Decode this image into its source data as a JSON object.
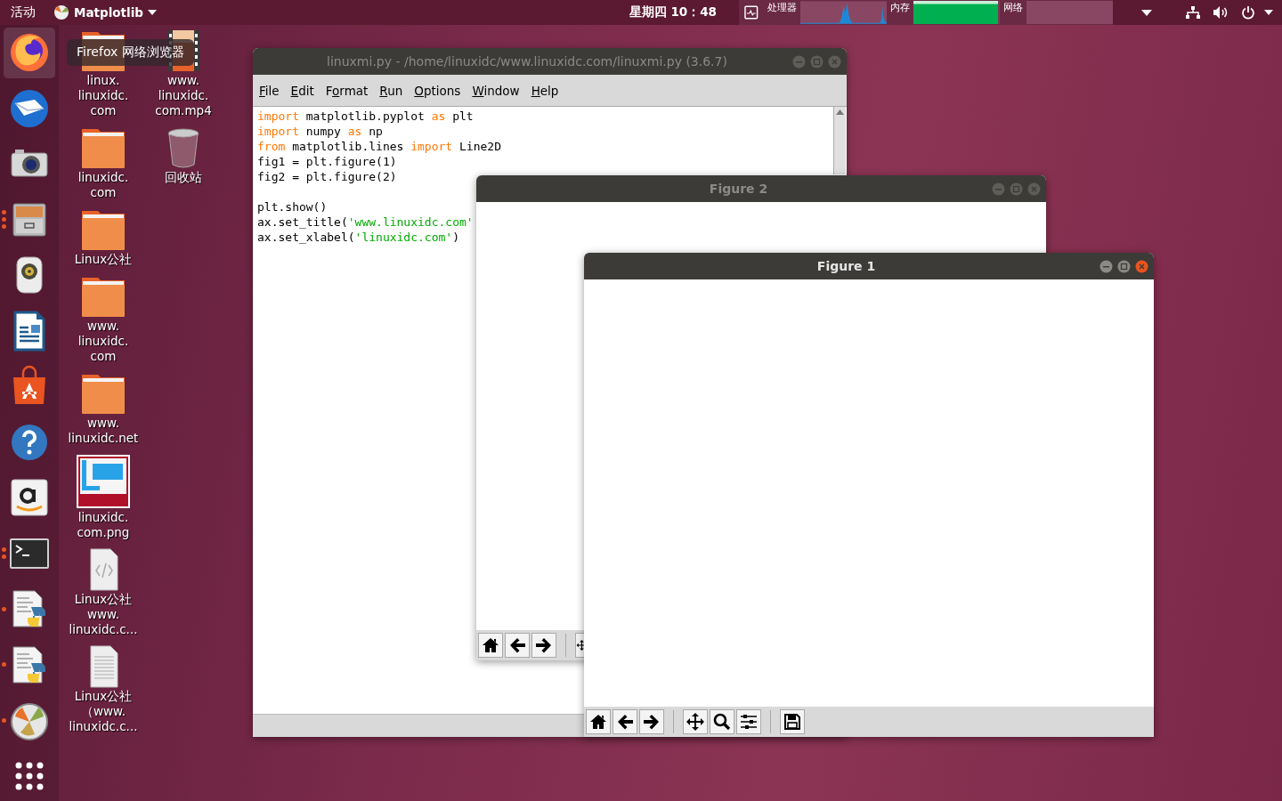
{
  "top_bar": {
    "activities": "活动",
    "app_menu": {
      "name": "Matplotlib"
    },
    "clock": "星期四 10：48",
    "monitor": {
      "cpu_label": "处理器",
      "memory_label": "内存",
      "memory": {
        "level": 0.98
      },
      "network_label": "网络"
    }
  },
  "dock": {
    "items": [
      {
        "kind": "firefox",
        "selected": true
      },
      {
        "kind": "mail",
        "selected": false
      },
      {
        "kind": "camera",
        "selected": false
      },
      {
        "kind": "files",
        "selected": false,
        "indicators": [
          {
            "kind": "dot"
          },
          {
            "kind": "dot"
          },
          {
            "kind": "dot"
          }
        ]
      },
      {
        "kind": "speaker",
        "selected": false
      },
      {
        "kind": "document",
        "selected": false
      },
      {
        "kind": "store",
        "selected": false
      },
      {
        "kind": "help",
        "selected": false
      },
      {
        "kind": "amazon",
        "selected": false
      },
      {
        "kind": "terminal",
        "selected": false,
        "indicators": [
          {
            "kind": "dot"
          },
          {
            "kind": "dot"
          }
        ]
      },
      {
        "kind": "python",
        "selected": false,
        "indicators": [
          {
            "kind": "dot"
          }
        ]
      },
      {
        "kind": "python",
        "selected": false,
        "indicators": [
          {
            "kind": "dot"
          }
        ]
      },
      {
        "kind": "plot",
        "selected": false,
        "indicators": [
          {
            "kind": "dot"
          }
        ]
      },
      {
        "kind": "grid",
        "selected": false
      }
    ],
    "tooltip": "Firefox 网络浏览器"
  },
  "desktop": {
    "columns": [
      {
        "items": [
          {
            "kind": "folder",
            "label_lines": [
              "linux.",
              "linuxidc.",
              "com"
            ]
          },
          {
            "kind": "folder",
            "label_lines": [
              "linuxidc.",
              "com"
            ]
          },
          {
            "kind": "folder",
            "label_lines": [
              "Linux公社"
            ]
          },
          {
            "kind": "folder",
            "label_lines": [
              "www.",
              "linuxidc.",
              "com"
            ]
          },
          {
            "kind": "folder",
            "label_lines": [
              "www.",
              "linuxidc.net"
            ]
          },
          {
            "kind": "image",
            "label_lines": [
              "linuxidc.",
              "com.png"
            ]
          },
          {
            "kind": "code",
            "label_lines": [
              "Linux公社",
              "www.",
              "linuxidc.c..."
            ]
          },
          {
            "kind": "text",
            "label_lines": [
              "Linux公社",
              "（www.",
              "linuxidc.c..."
            ]
          }
        ]
      },
      {
        "items": [
          {
            "kind": "video",
            "label_lines": [
              "www.",
              "linuxidc.",
              "com.mp4"
            ]
          },
          {
            "kind": "trash",
            "label_lines": [
              "回收站"
            ]
          }
        ]
      }
    ]
  },
  "editor": {
    "title": "linuxmi.py - /home/linuxidc/www.linuxidc.com/linuxmi.py (3.6.7)",
    "active": false,
    "menu": [
      {
        "key": "F",
        "after": "ile"
      },
      {
        "key": "E",
        "after": "dit"
      },
      {
        "before": "F",
        "key": "o",
        "after": "rmat"
      },
      {
        "key": "R",
        "after": "un"
      },
      {
        "key": "O",
        "after": "ptions"
      },
      {
        "key": "W",
        "after": "indow"
      },
      {
        "key": "H",
        "after": "elp"
      }
    ],
    "lines": [
      {
        "tokens": [
          {
            "kind": "keyword",
            "text": "import"
          },
          {
            "kind": "plain",
            "text": " matplotlib.pyplot "
          },
          {
            "kind": "keyword",
            "text": "as"
          },
          {
            "kind": "plain",
            "text": " plt"
          }
        ]
      },
      {
        "tokens": [
          {
            "kind": "keyword",
            "text": "import"
          },
          {
            "kind": "plain",
            "text": " numpy "
          },
          {
            "kind": "keyword",
            "text": "as"
          },
          {
            "kind": "plain",
            "text": " np"
          }
        ]
      },
      {
        "tokens": [
          {
            "kind": "keyword",
            "text": "from"
          },
          {
            "kind": "plain",
            "text": " matplotlib.lines "
          },
          {
            "kind": "keyword",
            "text": "import"
          },
          {
            "kind": "plain",
            "text": " Line2D"
          }
        ]
      },
      {
        "tokens": [
          {
            "kind": "plain",
            "text": "fig1 = plt.figure(1)"
          }
        ]
      },
      {
        "tokens": [
          {
            "kind": "plain",
            "text": "fig2 = plt.figure(2)"
          }
        ]
      },
      {
        "kind": "blank"
      },
      {
        "tokens": [
          {
            "kind": "plain",
            "text": "plt.show()"
          }
        ]
      },
      {
        "tokens": [
          {
            "kind": "plain",
            "text": "ax.set_title("
          },
          {
            "kind": "string",
            "text": "'www.linuxidc.com'"
          }
        ]
      },
      {
        "tokens": [
          {
            "kind": "plain",
            "text": "ax.set_xlabel("
          },
          {
            "kind": "string",
            "text": "'linuxidc.com'"
          },
          {
            "kind": "plain",
            "text": ")"
          }
        ]
      }
    ]
  },
  "figures": [
    {
      "title": "Figure 2",
      "active": false,
      "toolbar": [
        {
          "kind": "home"
        },
        {
          "kind": "back"
        },
        {
          "kind": "forward"
        },
        {
          "kind": "separator"
        },
        {
          "kind": "move"
        }
      ]
    },
    {
      "title": "Figure 1",
      "active": true,
      "toolbar": [
        {
          "kind": "home"
        },
        {
          "kind": "back"
        },
        {
          "kind": "forward"
        },
        {
          "kind": "separator"
        },
        {
          "kind": "move"
        },
        {
          "kind": "zoom"
        },
        {
          "kind": "configure"
        },
        {
          "kind": "separator"
        },
        {
          "kind": "save"
        }
      ]
    }
  ]
}
